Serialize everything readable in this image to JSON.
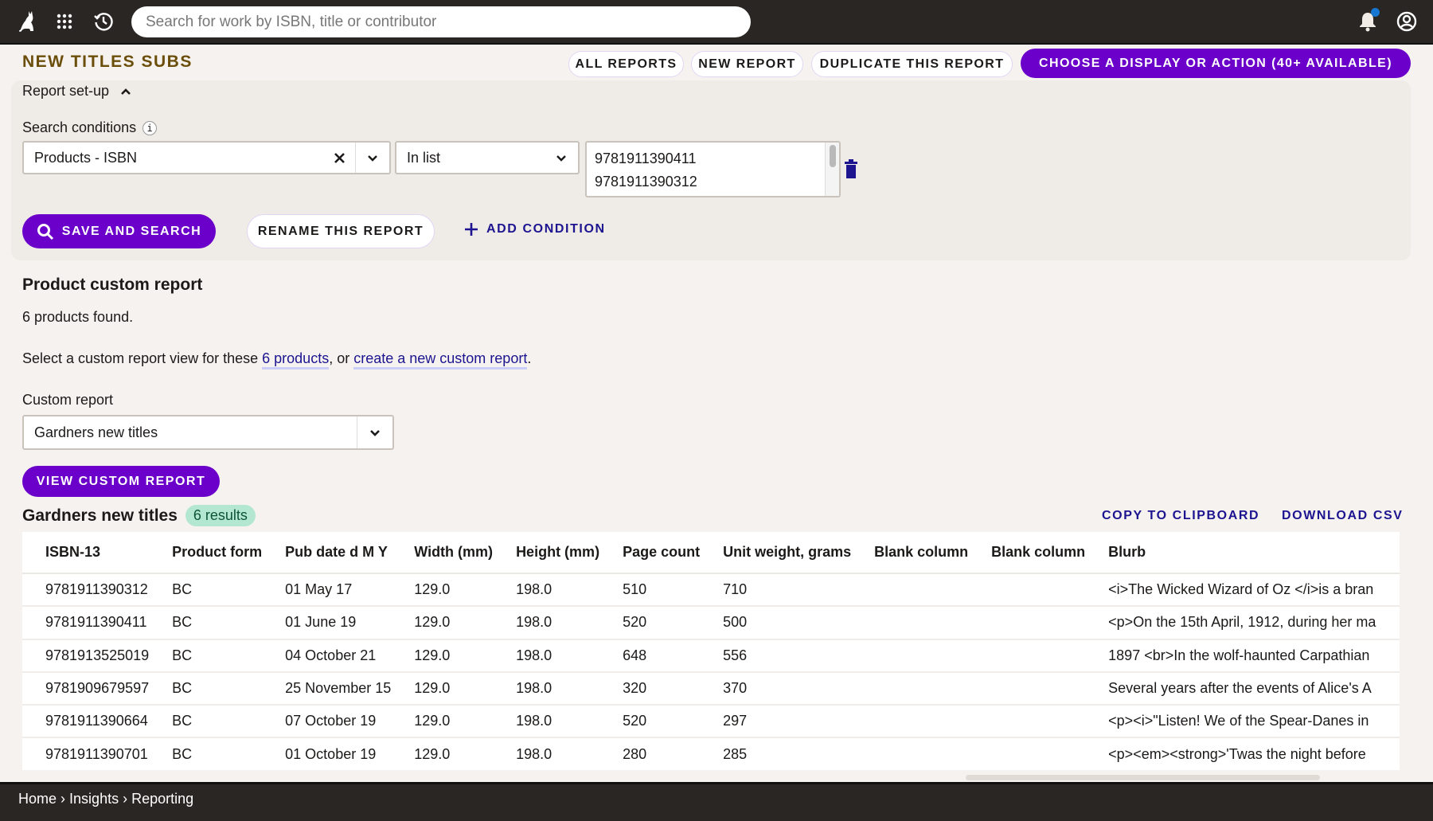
{
  "topbar": {
    "search_placeholder": "Search for work by ISBN, title or contributor",
    "icons": [
      "cat-logo-icon",
      "apps-grid-icon",
      "history-icon",
      "notification-bell-icon",
      "account-icon"
    ],
    "notification_dot_color": "#1677d2"
  },
  "header": {
    "title": "NEW TITLES SUBS",
    "buttons": {
      "all_reports": "ALL REPORTS",
      "new_report": "NEW REPORT",
      "duplicate": "DUPLICATE THIS REPORT",
      "choose_action": "CHOOSE A DISPLAY OR ACTION (40+ AVAILABLE)"
    }
  },
  "setup": {
    "toggle_label": "Report set-up",
    "search_conditions_label": "Search conditions",
    "condition": {
      "field": "Products - ISBN",
      "operator": "In list",
      "values": [
        "9781911390411",
        "9781911390312"
      ]
    },
    "save_and_search": "SAVE AND SEARCH",
    "rename": "RENAME THIS REPORT",
    "add_condition": "ADD CONDITION"
  },
  "report": {
    "heading": "Product custom report",
    "found_text": "6 products found.",
    "select_prefix": "Select a custom report view for these ",
    "products_link": "6 products",
    "select_middle": ", or ",
    "create_link": "create a new custom report",
    "select_suffix": ".",
    "custom_report_label": "Custom report",
    "custom_report_selected": "Gardners new titles",
    "view_button": "VIEW CUSTOM REPORT"
  },
  "results": {
    "title": "Gardners new titles",
    "badge": "6 results",
    "copy": "COPY TO CLIPBOARD",
    "download": "DOWNLOAD CSV",
    "columns": [
      "ISBN-13",
      "Product form",
      "Pub date d M Y",
      "Width (mm)",
      "Height (mm)",
      "Page count",
      "Unit weight, grams",
      "Blank column",
      "Blank column",
      "Blurb"
    ],
    "rows": [
      [
        "9781911390312",
        "BC",
        "01 May 17",
        "129.0",
        "198.0",
        "510",
        "710",
        "",
        "",
        "<i>The Wicked Wizard of Oz </i>is a bran"
      ],
      [
        "9781911390411",
        "BC",
        "01 June 19",
        "129.0",
        "198.0",
        "520",
        "500",
        "",
        "",
        "<p>On the 15th April, 1912, during her ma"
      ],
      [
        "9781913525019",
        "BC",
        "04 October 21",
        "129.0",
        "198.0",
        "648",
        "556",
        "",
        "",
        "1897 <br>In the wolf-haunted Carpathian"
      ],
      [
        "9781909679597",
        "BC",
        "25 November 15",
        "129.0",
        "198.0",
        "320",
        "370",
        "",
        "",
        "Several years after the events of Alice's A"
      ],
      [
        "9781911390664",
        "BC",
        "07 October 19",
        "129.0",
        "198.0",
        "520",
        "297",
        "",
        "",
        "<p><i>\"Listen! We of the Spear-Danes in"
      ],
      [
        "9781911390701",
        "BC",
        "01 October 19",
        "129.0",
        "198.0",
        "280",
        "285",
        "",
        "",
        "<p><em><strong>'Twas the night before"
      ]
    ]
  },
  "footer": {
    "breadcrumb": [
      "Home",
      "Insights",
      "Reporting"
    ],
    "separator": "›"
  },
  "colors": {
    "accent": "#6a00c9",
    "link": "#1d1490",
    "title": "#6b4e0a",
    "topbar": "#2a2624",
    "badge_bg": "#b3e7d2"
  }
}
